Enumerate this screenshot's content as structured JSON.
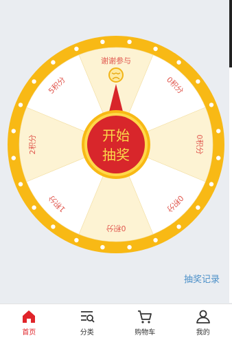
{
  "wheel": {
    "center_label_line1": "开始",
    "center_label_line2": "抽奖",
    "segments": [
      {
        "label": "谢谢参与",
        "face": true,
        "fill": "#fdf3d3"
      },
      {
        "label": "0积分",
        "fill": "#ffffff"
      },
      {
        "label": "0积分",
        "fill": "#fdf3d3"
      },
      {
        "label": "0积分",
        "fill": "#ffffff"
      },
      {
        "label": "0积分",
        "fill": "#fdf3d3"
      },
      {
        "label": "1积分",
        "fill": "#ffffff"
      },
      {
        "label": "2积分",
        "fill": "#fdf3d3"
      },
      {
        "label": "5积分",
        "fill": "#ffffff"
      }
    ],
    "colors": {
      "rim": "#f8b915",
      "lights": "#ffffff",
      "label_text": "#e0584f",
      "hub_red": "#d8262b",
      "hub_gold": "#f8b915",
      "hub_text": "#fbd84a"
    }
  },
  "records_link": "抽奖记录",
  "tabbar": {
    "items": [
      {
        "label": "首页",
        "icon": "home-icon",
        "active": true
      },
      {
        "label": "分类",
        "icon": "category-search-icon",
        "active": false
      },
      {
        "label": "购物车",
        "icon": "cart-icon",
        "active": false
      },
      {
        "label": "我的",
        "icon": "user-icon",
        "active": false
      }
    ]
  }
}
